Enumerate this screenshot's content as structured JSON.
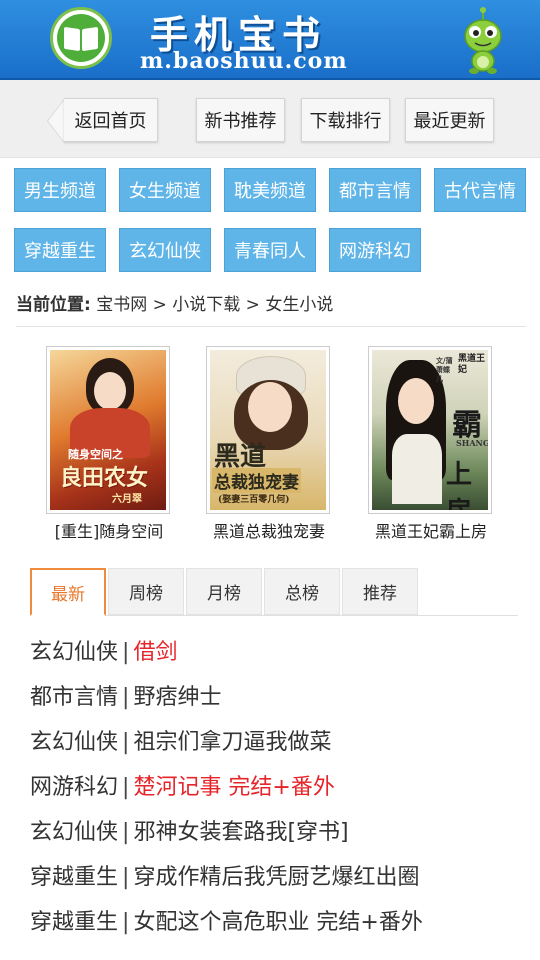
{
  "header": {
    "title": "手机宝书",
    "url": "m.baoshuu.com"
  },
  "topnav": {
    "back": "返回首页",
    "new_books": "新书推荐",
    "download_rank": "下载排行",
    "recent_update": "最近更新"
  },
  "categories": [
    "男生频道",
    "女生频道",
    "耽美频道",
    "都市言情",
    "古代言情",
    "穿越重生",
    "玄幻仙侠",
    "青春同人",
    "网游科幻"
  ],
  "breadcrumb": {
    "label": "当前位置:",
    "path": "宝书网 > 小说下载 > 女生小说"
  },
  "books": [
    {
      "title": "[重生]随身空间",
      "cover_text": "良田农女",
      "cover_sub": "随身空间之",
      "cover_author": "六月翠"
    },
    {
      "title": "黑道总裁独宠妻",
      "cover_text": "黑道",
      "cover_text2": "总裁独宠妻",
      "cover_sub": "(娶妻三百零几何)"
    },
    {
      "title": "黑道王妃霸上房",
      "cover_text": "霸",
      "cover_text2": "上房",
      "cover_sub": "黑道王妃",
      "cover_author": "文/蒲萧蝶儿",
      "cover_en": "SHANG"
    }
  ],
  "tabs": [
    "最新",
    "周榜",
    "月榜",
    "总榜",
    "推荐"
  ],
  "active_tab": "最新",
  "list": [
    {
      "category": "玄幻仙侠",
      "title": "借剑",
      "highlight": true
    },
    {
      "category": "都市言情",
      "title": "野痞绅士",
      "highlight": false
    },
    {
      "category": "玄幻仙侠",
      "title": "祖宗们拿刀逼我做菜",
      "highlight": false
    },
    {
      "category": "网游科幻",
      "title": "楚河记事 完结+番外",
      "highlight": true
    },
    {
      "category": "玄幻仙侠",
      "title": "邪神女装套路我[穿书]",
      "highlight": false
    },
    {
      "category": "穿越重生",
      "title": "穿成作精后我凭厨艺爆红出圈",
      "highlight": false
    },
    {
      "category": "穿越重生",
      "title": "女配这个高危职业 完结+番外",
      "highlight": false
    }
  ],
  "colors": {
    "header_blue": "#1a6fc9",
    "category_blue": "#5fb4e8",
    "active_tab_orange": "#e8772a",
    "highlight_red": "#e5252a"
  },
  "icons": [
    "book-logo-icon",
    "frog-mascot-icon"
  ]
}
